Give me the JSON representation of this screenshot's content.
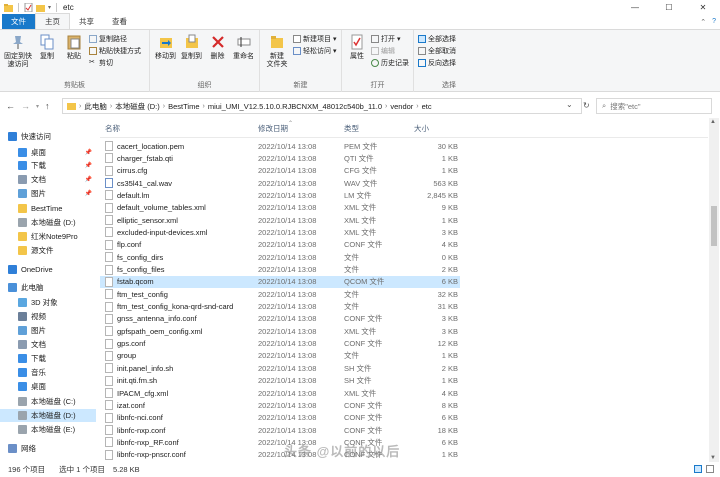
{
  "window": {
    "title": "etc",
    "controls": [
      "—",
      "☐",
      "✕"
    ]
  },
  "ribbon_tabs": {
    "file": "文件",
    "home": "主页",
    "share": "共享",
    "view": "查看"
  },
  "ribbon": {
    "clipboard": {
      "label": "剪贴板",
      "pin": "固定到快\n速访问",
      "copy": "复制",
      "paste": "粘贴",
      "copy_path": "复制路径",
      "paste_shortcut": "粘贴快捷方式",
      "cut": "剪切"
    },
    "organize": {
      "label": "组织",
      "move_to": "移动到",
      "copy_to": "复制到",
      "delete": "删除",
      "rename": "重命名"
    },
    "new": {
      "label": "新建",
      "new_folder": "新建\n文件夹",
      "new_item": "新建项目 ▾",
      "easy_access": "轻松访问 ▾"
    },
    "open": {
      "label": "打开",
      "properties": "属性",
      "open": "打开 ▾",
      "edit": "编辑",
      "history": "历史记录"
    },
    "select": {
      "label": "选择",
      "select_all": "全部选择",
      "select_none": "全部取消",
      "invert": "反向选择"
    }
  },
  "address": {
    "crumbs": [
      "此电脑",
      "本地磁盘 (D:)",
      "BestTime",
      "miui_UMI_V12.5.10.0.RJBCNXM_48012c540b_11.0",
      "vendor",
      "etc"
    ],
    "search_placeholder": "搜索\"etc\""
  },
  "sidebar": {
    "items": [
      {
        "label": "快速访问",
        "color": "#2f7fd8"
      },
      {
        "label": "桌面",
        "color": "#3a8ee6",
        "pinned": true
      },
      {
        "label": "下载",
        "color": "#3a8ee6",
        "pinned": true
      },
      {
        "label": "文档",
        "color": "#8a9bb0",
        "pinned": true
      },
      {
        "label": "图片",
        "color": "#5fa0d8",
        "pinned": true
      },
      {
        "label": "BestTime",
        "color": "#f3c549"
      },
      {
        "label": "本地磁盘 (D:)",
        "color": "#9aa4ad"
      },
      {
        "label": "红米Note9Pro",
        "color": "#f3c549"
      },
      {
        "label": "源文件",
        "color": "#f3c549"
      },
      {
        "label": "OneDrive",
        "color": "#2f7fd8"
      },
      {
        "label": "此电脑",
        "color": "#4a90d9"
      },
      {
        "label": "3D 对象",
        "color": "#5aa7e0"
      },
      {
        "label": "视频",
        "color": "#6b7f99"
      },
      {
        "label": "图片",
        "color": "#5fa0d8"
      },
      {
        "label": "文档",
        "color": "#8a9bb0"
      },
      {
        "label": "下载",
        "color": "#3a8ee6"
      },
      {
        "label": "音乐",
        "color": "#3a8ee6"
      },
      {
        "label": "桌面",
        "color": "#3a8ee6"
      },
      {
        "label": "本地磁盘 (C:)",
        "color": "#9aa4ad"
      },
      {
        "label": "本地磁盘 (D:)",
        "color": "#9aa4ad",
        "selected": true
      },
      {
        "label": "本地磁盘 (E:)",
        "color": "#9aa4ad"
      },
      {
        "label": "网络",
        "color": "#6b8fc7"
      }
    ]
  },
  "columns": {
    "name": "名称",
    "date": "修改日期",
    "type": "类型",
    "size": "大小"
  },
  "files": [
    {
      "name": "cacert_location.pem",
      "date": "2022/10/14 13:08",
      "type": "PEM 文件",
      "size": "30 KB"
    },
    {
      "name": "charger_fstab.qti",
      "date": "2022/10/14 13:08",
      "type": "QTI 文件",
      "size": "1 KB"
    },
    {
      "name": "cirrus.cfg",
      "date": "2022/10/14 13:08",
      "type": "CFG 文件",
      "size": "1 KB"
    },
    {
      "name": "cs35l41_cal.wav",
      "date": "2022/10/14 13:08",
      "type": "WAV 文件",
      "size": "563 KB",
      "icon": "wav"
    },
    {
      "name": "default.lm",
      "date": "2022/10/14 13:08",
      "type": "LM 文件",
      "size": "2,845 KB"
    },
    {
      "name": "default_volume_tables.xml",
      "date": "2022/10/14 13:08",
      "type": "XML 文件",
      "size": "9 KB"
    },
    {
      "name": "elliptic_sensor.xml",
      "date": "2022/10/14 13:08",
      "type": "XML 文件",
      "size": "1 KB"
    },
    {
      "name": "excluded-input-devices.xml",
      "date": "2022/10/14 13:08",
      "type": "XML 文件",
      "size": "3 KB"
    },
    {
      "name": "flp.conf",
      "date": "2022/10/14 13:08",
      "type": "CONF 文件",
      "size": "4 KB"
    },
    {
      "name": "fs_config_dirs",
      "date": "2022/10/14 13:08",
      "type": "文件",
      "size": "0 KB"
    },
    {
      "name": "fs_config_files",
      "date": "2022/10/14 13:08",
      "type": "文件",
      "size": "2 KB"
    },
    {
      "name": "fstab.qcom",
      "date": "2022/10/14 13:08",
      "type": "QCOM 文件",
      "size": "6 KB",
      "selected": true
    },
    {
      "name": "ftm_test_config",
      "date": "2022/10/14 13:08",
      "type": "文件",
      "size": "32 KB"
    },
    {
      "name": "ftm_test_config_kona-qrd-snd-card",
      "date": "2022/10/14 13:08",
      "type": "文件",
      "size": "31 KB"
    },
    {
      "name": "gnss_antenna_info.conf",
      "date": "2022/10/14 13:08",
      "type": "CONF 文件",
      "size": "3 KB"
    },
    {
      "name": "gpfspath_oem_config.xml",
      "date": "2022/10/14 13:08",
      "type": "XML 文件",
      "size": "3 KB"
    },
    {
      "name": "gps.conf",
      "date": "2022/10/14 13:08",
      "type": "CONF 文件",
      "size": "12 KB"
    },
    {
      "name": "group",
      "date": "2022/10/14 13:08",
      "type": "文件",
      "size": "1 KB"
    },
    {
      "name": "init.panel_info.sh",
      "date": "2022/10/14 13:08",
      "type": "SH 文件",
      "size": "2 KB"
    },
    {
      "name": "init.qti.fm.sh",
      "date": "2022/10/14 13:08",
      "type": "SH 文件",
      "size": "1 KB"
    },
    {
      "name": "IPACM_cfg.xml",
      "date": "2022/10/14 13:08",
      "type": "XML 文件",
      "size": "4 KB"
    },
    {
      "name": "izat.conf",
      "date": "2022/10/14 13:08",
      "type": "CONF 文件",
      "size": "8 KB"
    },
    {
      "name": "libnfc-nci.conf",
      "date": "2022/10/14 13:08",
      "type": "CONF 文件",
      "size": "6 KB"
    },
    {
      "name": "libnfc-nxp.conf",
      "date": "2022/10/14 13:08",
      "type": "CONF 文件",
      "size": "18 KB"
    },
    {
      "name": "libnfc-nxp_RF.conf",
      "date": "2022/10/14 13:08",
      "type": "CONF 文件",
      "size": "6 KB"
    },
    {
      "name": "libnfc-nxp-pnscr.conf",
      "date": "2022/10/14 13:08",
      "type": "CONF 文件",
      "size": "1 KB"
    }
  ],
  "status": {
    "count": "196 个项目",
    "selected": "选中 1 个项目",
    "size": "5.28 KB"
  },
  "watermark": "头条 @以前的以后"
}
